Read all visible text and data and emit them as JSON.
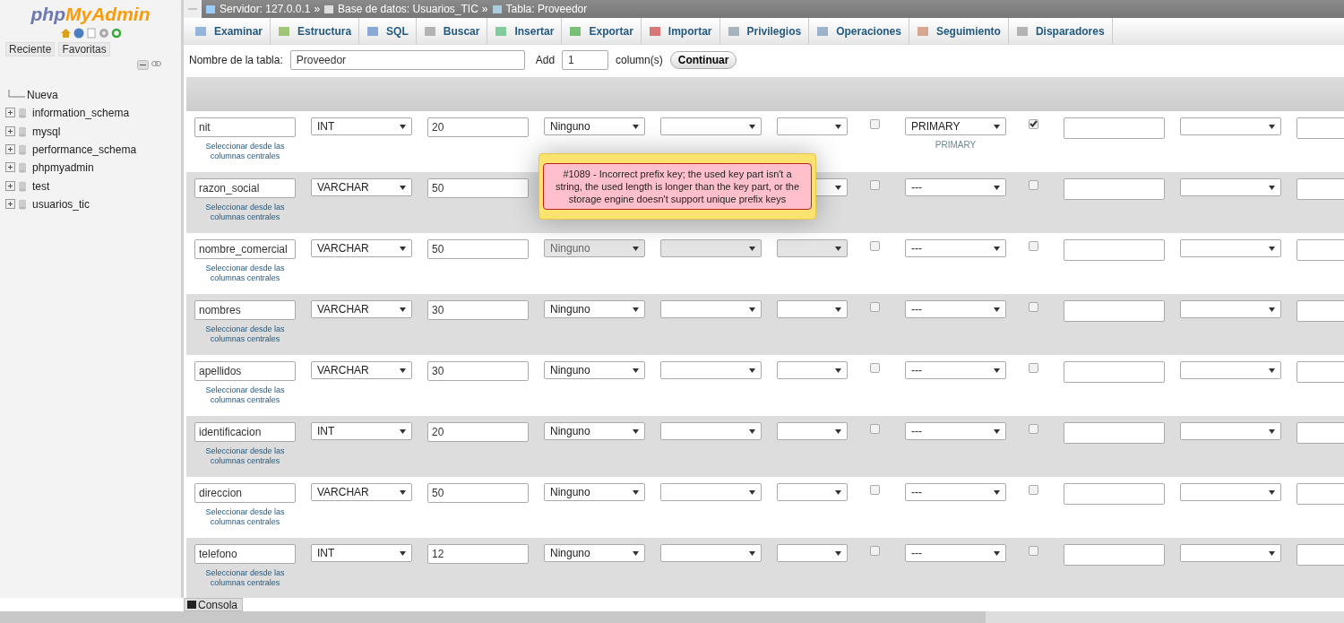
{
  "sidebar": {
    "logo": {
      "part1": "php",
      "part2": "MyAdmin"
    },
    "buttons": [
      "Reciente",
      "Favoritas"
    ],
    "tree": [
      {
        "label": "Nueva",
        "kind": "new"
      },
      {
        "label": "information_schema",
        "kind": "db"
      },
      {
        "label": "mysql",
        "kind": "db"
      },
      {
        "label": "performance_schema",
        "kind": "db"
      },
      {
        "label": "phpmyadmin",
        "kind": "db"
      },
      {
        "label": "test",
        "kind": "db"
      },
      {
        "label": "usuarios_tic",
        "kind": "db"
      }
    ]
  },
  "breadcrumb": [
    {
      "label": "Servidor: 127.0.0.1",
      "kind": "server"
    },
    {
      "label": "Base de datos: Usuarios_TIC",
      "kind": "db"
    },
    {
      "label": "Tabla: Proveedor",
      "kind": "table"
    }
  ],
  "breadcrumb_separator": "»",
  "tabs": [
    {
      "label": "Examinar",
      "kind": "browse"
    },
    {
      "label": "Estructura",
      "kind": "structure"
    },
    {
      "label": "SQL",
      "kind": "sql"
    },
    {
      "label": "Buscar",
      "kind": "search"
    },
    {
      "label": "Insertar",
      "kind": "insert"
    },
    {
      "label": "Exportar",
      "kind": "export"
    },
    {
      "label": "Importar",
      "kind": "import"
    },
    {
      "label": "Privilegios",
      "kind": "privileges"
    },
    {
      "label": "Operaciones",
      "kind": "operations"
    },
    {
      "label": "Seguimiento",
      "kind": "tracking"
    },
    {
      "label": "Disparadores",
      "kind": "triggers"
    }
  ],
  "form": {
    "table_label": "Nombre de la tabla:",
    "table_name": "Proveedor",
    "add_label": "Add",
    "add_count": "1",
    "columns_label": "column(s)",
    "button": "Continuar"
  },
  "rows": [
    {
      "name": "nit",
      "type": "INT",
      "length": "20",
      "default": "Ninguno",
      "disabled": false,
      "null": false,
      "index": "PRIMARY",
      "index_label": "PRIMARY",
      "ai": true,
      "link": "Seleccionar desde las columnas centrales"
    },
    {
      "name": "razon_social",
      "type": "VARCHAR",
      "length": "50",
      "null": false,
      "index": "---",
      "ai": false,
      "link": "Seleccionar desde las columnas centrales"
    },
    {
      "name": "nombre_comercial",
      "type": "VARCHAR",
      "length": "50",
      "default": "Ninguno",
      "disabled": true,
      "null": false,
      "index": "---",
      "ai": false,
      "link": "Seleccionar desde las columnas centrales"
    },
    {
      "name": "nombres",
      "type": "VARCHAR",
      "length": "30",
      "default": "Ninguno",
      "disabled": false,
      "null": false,
      "index": "---",
      "ai": false,
      "link": "Seleccionar desde las columnas centrales"
    },
    {
      "name": "apellidos",
      "type": "VARCHAR",
      "length": "30",
      "default": "Ninguno",
      "disabled": false,
      "null": false,
      "index": "---",
      "ai": false,
      "link": "Seleccionar desde las columnas centrales"
    },
    {
      "name": "identificacion",
      "type": "INT",
      "length": "20",
      "default": "Ninguno",
      "disabled": false,
      "null": false,
      "index": "---",
      "ai": false,
      "link": "Seleccionar desde las columnas centrales"
    },
    {
      "name": "direccion",
      "type": "VARCHAR",
      "length": "50",
      "default": "Ninguno",
      "disabled": false,
      "null": false,
      "index": "---",
      "ai": false,
      "link": "Seleccionar desde las columnas centrales"
    },
    {
      "name": "telefono",
      "type": "INT",
      "length": "12",
      "default": "Ninguno",
      "disabled": false,
      "null": false,
      "index": "---",
      "ai": false,
      "link": "Seleccionar desde las columnas centrales"
    }
  ],
  "error": "#1089 - Incorrect prefix key; the used key part isn't a string, the used length is longer than the key part, or the storage engine doesn't support unique prefix keys",
  "console": "Consola"
}
